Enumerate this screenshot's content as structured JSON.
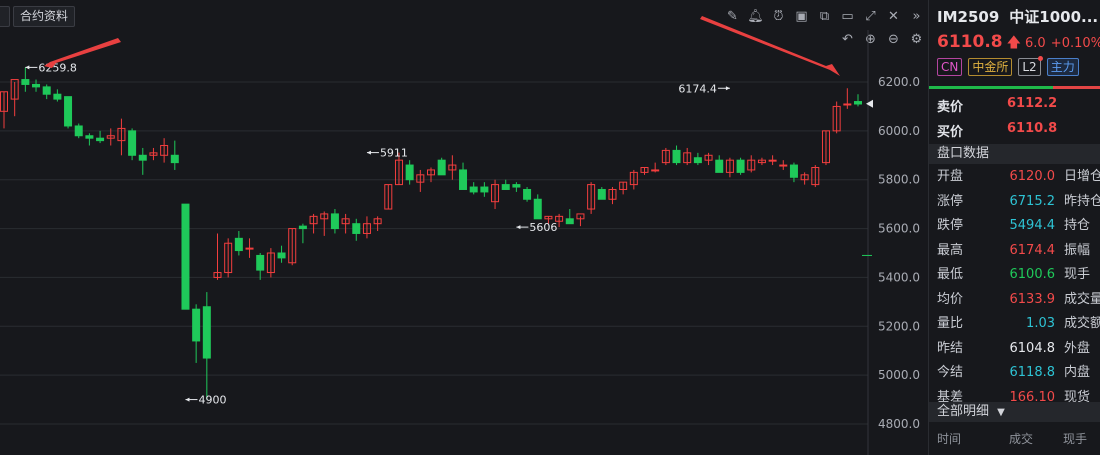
{
  "toolbar": {
    "tab_label": "合约资料",
    "icons": [
      "pen-icon",
      "bell-icon",
      "alarm-icon",
      "camera-icon",
      "copy-icon",
      "monitor-icon",
      "fullscreen-icon",
      "close-icon",
      "collapse-icon"
    ],
    "icons2": [
      "undo-icon",
      "zoom-in-icon",
      "zoom-out-icon",
      "settings-icon"
    ]
  },
  "chart_data": {
    "type": "candlestick",
    "ylim": [
      4800,
      6240
    ],
    "yticks": [
      "6200.0",
      "6000.0",
      "5800.0",
      "5600.0",
      "5400.0",
      "5200.0",
      "5000.0",
      "4800.0"
    ],
    "annotations": [
      {
        "text": "6259.8",
        "candle": 2,
        "price": 6259.8
      },
      {
        "text": "5911",
        "candle": 34,
        "price": 5911
      },
      {
        "text": "4900",
        "candle": 17,
        "price": 4900
      },
      {
        "text": "5606",
        "candle": 48,
        "price": 5606
      },
      {
        "text": "6174.4",
        "candle": 68,
        "price": 6174.4
      }
    ],
    "candles": [
      {
        "o": 6080,
        "h": 6160,
        "l": 6010,
        "c": 6160
      },
      {
        "o": 6130,
        "h": 6200,
        "l": 6060,
        "c": 6210
      },
      {
        "o": 6210,
        "h": 6259.8,
        "l": 6160,
        "c": 6190
      },
      {
        "o": 6190,
        "h": 6210,
        "l": 6160,
        "c": 6180
      },
      {
        "o": 6180,
        "h": 6190,
        "l": 6130,
        "c": 6150
      },
      {
        "o": 6150,
        "h": 6170,
        "l": 6120,
        "c": 6130
      },
      {
        "o": 6140,
        "h": 6140,
        "l": 6010,
        "c": 6020
      },
      {
        "o": 6020,
        "h": 6030,
        "l": 5970,
        "c": 5980
      },
      {
        "o": 5980,
        "h": 5990,
        "l": 5940,
        "c": 5970
      },
      {
        "o": 5970,
        "h": 6000,
        "l": 5950,
        "c": 5960
      },
      {
        "o": 5970,
        "h": 6010,
        "l": 5940,
        "c": 5980
      },
      {
        "o": 5960,
        "h": 6050,
        "l": 5900,
        "c": 6010
      },
      {
        "o": 6000,
        "h": 6010,
        "l": 5880,
        "c": 5900
      },
      {
        "o": 5900,
        "h": 5930,
        "l": 5820,
        "c": 5880
      },
      {
        "o": 5900,
        "h": 5930,
        "l": 5880,
        "c": 5910
      },
      {
        "o": 5900,
        "h": 5970,
        "l": 5870,
        "c": 5940
      },
      {
        "o": 5900,
        "h": 5960,
        "l": 5840,
        "c": 5870
      },
      {
        "o": 5700,
        "h": 5700,
        "l": 5270,
        "c": 5270
      },
      {
        "o": 5270,
        "h": 5290,
        "l": 5050,
        "c": 5140
      },
      {
        "o": 5280,
        "h": 5340,
        "l": 4900,
        "c": 5070
      },
      {
        "o": 5400,
        "h": 5580,
        "l": 5390,
        "c": 5420
      },
      {
        "o": 5420,
        "h": 5560,
        "l": 5400,
        "c": 5540
      },
      {
        "o": 5560,
        "h": 5590,
        "l": 5490,
        "c": 5510
      },
      {
        "o": 5520,
        "h": 5560,
        "l": 5480,
        "c": 5520
      },
      {
        "o": 5490,
        "h": 5500,
        "l": 5390,
        "c": 5430
      },
      {
        "o": 5420,
        "h": 5520,
        "l": 5400,
        "c": 5500
      },
      {
        "o": 5500,
        "h": 5530,
        "l": 5460,
        "c": 5480
      },
      {
        "o": 5460,
        "h": 5600,
        "l": 5450,
        "c": 5600
      },
      {
        "o": 5610,
        "h": 5620,
        "l": 5540,
        "c": 5600
      },
      {
        "o": 5620,
        "h": 5660,
        "l": 5580,
        "c": 5650
      },
      {
        "o": 5640,
        "h": 5670,
        "l": 5570,
        "c": 5660
      },
      {
        "o": 5660,
        "h": 5680,
        "l": 5580,
        "c": 5600
      },
      {
        "o": 5620,
        "h": 5660,
        "l": 5580,
        "c": 5640
      },
      {
        "o": 5620,
        "h": 5640,
        "l": 5550,
        "c": 5580
      },
      {
        "o": 5580,
        "h": 5650,
        "l": 5560,
        "c": 5620
      },
      {
        "o": 5620,
        "h": 5650,
        "l": 5590,
        "c": 5640
      },
      {
        "o": 5680,
        "h": 5780,
        "l": 5680,
        "c": 5780
      },
      {
        "o": 5780,
        "h": 5911,
        "l": 5780,
        "c": 5880
      },
      {
        "o": 5860,
        "h": 5880,
        "l": 5780,
        "c": 5800
      },
      {
        "o": 5790,
        "h": 5840,
        "l": 5750,
        "c": 5820
      },
      {
        "o": 5820,
        "h": 5850,
        "l": 5790,
        "c": 5840
      },
      {
        "o": 5880,
        "h": 5890,
        "l": 5830,
        "c": 5820
      },
      {
        "o": 5840,
        "h": 5900,
        "l": 5800,
        "c": 5860
      },
      {
        "o": 5840,
        "h": 5870,
        "l": 5760,
        "c": 5760
      },
      {
        "o": 5770,
        "h": 5790,
        "l": 5740,
        "c": 5750
      },
      {
        "o": 5770,
        "h": 5790,
        "l": 5730,
        "c": 5750
      },
      {
        "o": 5710,
        "h": 5800,
        "l": 5680,
        "c": 5780
      },
      {
        "o": 5780,
        "h": 5800,
        "l": 5760,
        "c": 5760
      },
      {
        "o": 5780,
        "h": 5790,
        "l": 5750,
        "c": 5770
      },
      {
        "o": 5760,
        "h": 5770,
        "l": 5710,
        "c": 5720
      },
      {
        "o": 5720,
        "h": 5740,
        "l": 5640,
        "c": 5640
      },
      {
        "o": 5640,
        "h": 5650,
        "l": 5620,
        "c": 5650
      },
      {
        "o": 5630,
        "h": 5660,
        "l": 5606,
        "c": 5650
      },
      {
        "o": 5640,
        "h": 5680,
        "l": 5620,
        "c": 5620
      },
      {
        "o": 5640,
        "h": 5650,
        "l": 5610,
        "c": 5660
      },
      {
        "o": 5680,
        "h": 5790,
        "l": 5660,
        "c": 5780
      },
      {
        "o": 5760,
        "h": 5770,
        "l": 5720,
        "c": 5720
      },
      {
        "o": 5720,
        "h": 5770,
        "l": 5700,
        "c": 5760
      },
      {
        "o": 5760,
        "h": 5790,
        "l": 5740,
        "c": 5790
      },
      {
        "o": 5780,
        "h": 5840,
        "l": 5760,
        "c": 5830
      },
      {
        "o": 5830,
        "h": 5850,
        "l": 5820,
        "c": 5850
      },
      {
        "o": 5840,
        "h": 5870,
        "l": 5830,
        "c": 5840
      },
      {
        "o": 5870,
        "h": 5930,
        "l": 5860,
        "c": 5920
      },
      {
        "o": 5920,
        "h": 5940,
        "l": 5860,
        "c": 5870
      },
      {
        "o": 5870,
        "h": 5930,
        "l": 5860,
        "c": 5910
      },
      {
        "o": 5890,
        "h": 5910,
        "l": 5860,
        "c": 5870
      },
      {
        "o": 5880,
        "h": 5910,
        "l": 5860,
        "c": 5900
      },
      {
        "o": 5880,
        "h": 5900,
        "l": 5830,
        "c": 5830
      },
      {
        "o": 5830,
        "h": 5890,
        "l": 5810,
        "c": 5880
      },
      {
        "o": 5880,
        "h": 5890,
        "l": 5820,
        "c": 5830
      },
      {
        "o": 5840,
        "h": 5900,
        "l": 5830,
        "c": 5880
      },
      {
        "o": 5870,
        "h": 5890,
        "l": 5860,
        "c": 5880
      },
      {
        "o": 5880,
        "h": 5900,
        "l": 5860,
        "c": 5880
      },
      {
        "o": 5860,
        "h": 5880,
        "l": 5840,
        "c": 5860
      },
      {
        "o": 5860,
        "h": 5870,
        "l": 5790,
        "c": 5810
      },
      {
        "o": 5800,
        "h": 5830,
        "l": 5780,
        "c": 5820
      },
      {
        "o": 5780,
        "h": 5860,
        "l": 5770,
        "c": 5850
      },
      {
        "o": 5870,
        "h": 6000,
        "l": 5860,
        "c": 6000
      },
      {
        "o": 6000,
        "h": 6120,
        "l": 5990,
        "c": 6100
      },
      {
        "o": 6110,
        "h": 6174.4,
        "l": 6090,
        "c": 6110
      },
      {
        "o": 6120,
        "h": 6150,
        "l": 6100,
        "c": 6110
      }
    ],
    "last_price": 6110.8,
    "right_marker_price": 5490
  },
  "panel": {
    "symbol": "IM2509",
    "name": "中证1000...",
    "price": "6110.8",
    "change": "6.0",
    "change_pct": "+0.10%",
    "tags": {
      "cn": "CN",
      "exchange": "中金所",
      "l2": "L2",
      "main": "主力"
    },
    "sell_label": "卖价",
    "sell_value": "6112.2",
    "buy_label": "买价",
    "buy_value": "6110.8",
    "section_quote": "盘口数据",
    "quote_rows": [
      {
        "label": "开盘",
        "value": "6120.0",
        "color": "red",
        "label2": "日增仓"
      },
      {
        "label": "涨停",
        "value": "6715.2",
        "color": "cyan",
        "label2": "昨持仓"
      },
      {
        "label": "跌停",
        "value": "5494.4",
        "color": "cyan",
        "label2": "持仓"
      },
      {
        "label": "最高",
        "value": "6174.4",
        "color": "red",
        "label2": "振幅"
      },
      {
        "label": "最低",
        "value": "6100.6",
        "color": "green",
        "label2": "现手"
      },
      {
        "label": "均价",
        "value": "6133.9",
        "color": "red",
        "label2": "成交量"
      },
      {
        "label": "量比",
        "value": "1.03",
        "color": "cyan",
        "label2": "成交额"
      },
      {
        "label": "昨结",
        "value": "6104.8",
        "color": "white",
        "label2": "外盘"
      },
      {
        "label": "今结",
        "value": "6118.8",
        "color": "cyan",
        "label2": "内盘"
      },
      {
        "label": "基差",
        "value": "166.10",
        "color": "red",
        "label2": "现货"
      }
    ],
    "section_detail": "全部明细",
    "detail_cols": [
      "时间",
      "成交",
      "现手"
    ]
  },
  "colors": {
    "up": "#f23e3e",
    "down": "#1fc95a",
    "bg": "#17181c",
    "grid": "#2a2c31"
  }
}
